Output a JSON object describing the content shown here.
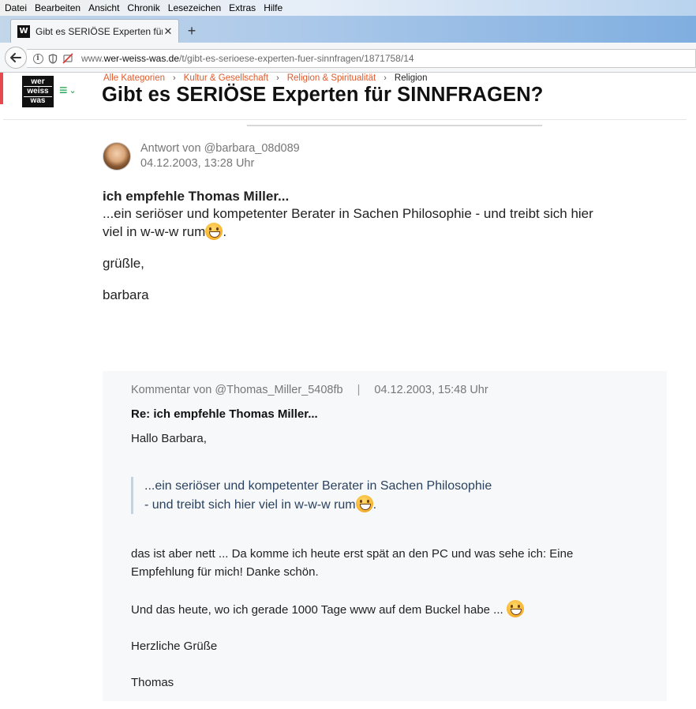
{
  "browser": {
    "menu": [
      "Datei",
      "Bearbeiten",
      "Ansicht",
      "Chronik",
      "Lesezeichen",
      "Extras",
      "Hilfe"
    ],
    "tab": {
      "title": "Gibt es SERIÖSE Experten für S",
      "favicon": "W"
    },
    "url": {
      "prefix": "www.",
      "domain": "wer-weiss-was.de",
      "path": "/t/gibt-es-serioese-experten-fuer-sinnfragen/1871758/14"
    }
  },
  "site": {
    "logo": [
      "wer",
      "weiss",
      "was"
    ],
    "breadcrumb": [
      "Alle Kategorien",
      "Kultur & Gesellschaft",
      "Religion & Spiritualität",
      "Religion"
    ],
    "title": "Gibt es SERIÖSE Experten für SINNFRAGEN?"
  },
  "post": {
    "author_line": "Antwort von @barbara_08d089",
    "date": "04.12.2003, 13:28 Uhr",
    "subject": "ich empfehle Thomas Miller...",
    "line1": "...ein seriöser und kompetenter Berater in Sachen Philosophie - und treibt sich hier",
    "line2": "viel in w-w-w rum",
    "line2_end": ".",
    "greeting": "grüßle,",
    "signature": "barbara"
  },
  "comment": {
    "author_line": "Kommentar von @Thomas_Miller_5408fb",
    "separator": "|",
    "date": "04.12.2003, 15:48 Uhr",
    "subject": "Re: ich empfehle Thomas Miller...",
    "salutation": "Hallo Barbara,",
    "quote_line1": "...ein seriöser und kompetenter Berater in Sachen Philosophie",
    "quote_line2": "- und treibt sich hier viel in w-w-w rum",
    "quote_end": ".",
    "para1_line1": "das ist aber nett ... Da komme ich heute erst spät an den PC und was sehe ich: Eine",
    "para1_line2": "Empfehlung für mich! Danke schön.",
    "para2": "Und das heute, wo ich gerade 1000 Tage www auf dem Buckel habe ... ",
    "closing": "Herzliche Grüße",
    "signature": "Thomas"
  }
}
